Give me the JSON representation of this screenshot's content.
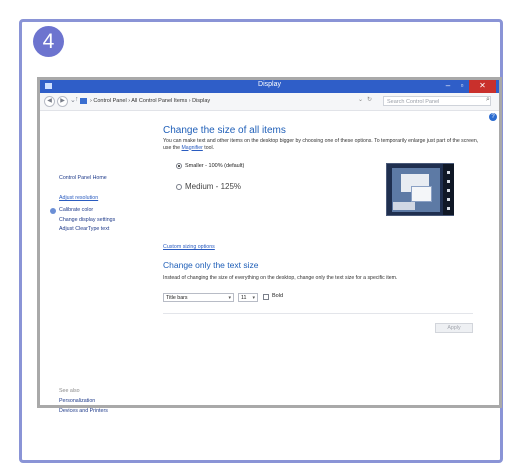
{
  "step_number": "4",
  "window": {
    "title": "Display",
    "controls": {
      "minimize": "–",
      "maximize": "▫",
      "close": "✕"
    }
  },
  "address": {
    "back": "◀",
    "forward": "▶",
    "recent": "⌄",
    "up": "↑",
    "breadcrumb": "› Control Panel › All Control Panel Items › Display",
    "dropdown": "⌄",
    "refresh": "↻",
    "search_placeholder": "Search Control Panel",
    "search_icon": "⌕"
  },
  "help_icon": "?",
  "left_pane": {
    "home": "Control Panel Home",
    "items": [
      "Adjust resolution",
      "Calibrate color",
      "Change display settings",
      "Adjust ClearType text"
    ],
    "see_also_label": "See also",
    "see_also": [
      "Personalization",
      "Devices and Printers"
    ]
  },
  "main": {
    "heading": "Change the size of all items",
    "description": "You can make text and other items on the desktop bigger by choosing one of these options. To temporarily enlarge just part of the screen, use the",
    "magnifier_link": "Magnifier",
    "description_end": "tool.",
    "options": [
      {
        "label": "Smaller - 100% (default)",
        "checked": true
      },
      {
        "label": "Medium - 125%",
        "checked": false
      }
    ],
    "custom_link": "Custom sizing options",
    "heading2": "Change only the text size",
    "description2": "Instead of changing the size of everything on the desktop, change only the text size for a specific item.",
    "item_select": "Title bars",
    "size_select": "11",
    "bold_label": "Bold",
    "apply_label": "Apply"
  },
  "colors": {
    "accent": "#6d74cf",
    "titlebar": "#2f5ec8",
    "close": "#c9302c",
    "link": "#2a5cc0"
  }
}
